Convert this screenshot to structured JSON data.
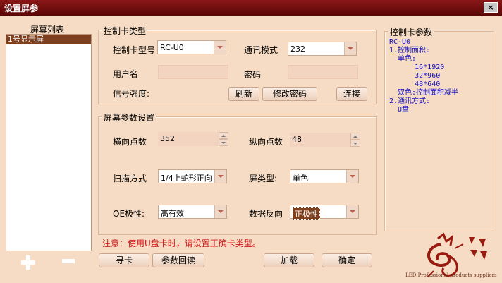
{
  "window": {
    "title": "设置屏参",
    "close_label": "×"
  },
  "screen_list": {
    "label": "屏幕列表",
    "items": [
      "1号显示屏"
    ]
  },
  "card_type": {
    "legend": "控制卡类型",
    "model_label": "控制卡型号",
    "model_value": "RC-U0",
    "comm_label": "通讯模式",
    "comm_value": "232",
    "username_label": "用户名",
    "password_label": "密码",
    "signal_label": "信号强度:",
    "refresh_label": "刷新",
    "change_pw_label": "修改密码",
    "connect_label": "连接"
  },
  "screen_params": {
    "legend": "屏幕参数设置",
    "width_label": "横向点数",
    "width_value": "352",
    "height_label": "纵向点数",
    "height_value": "48",
    "scan_label": "扫描方式",
    "scan_value": "1/4上蛇形正向",
    "screen_type_label": "屏类型:",
    "screen_type_value": "单色",
    "oe_label": "OE极性:",
    "oe_value": "高有效",
    "data_label": "数据反向",
    "data_value": "正极性"
  },
  "card_params": {
    "legend": "控制卡参数",
    "text": "RC-U0\n1.控制面积:\n  单色:\n      16*1920\n      32*960\n      48*640\n  双色:控制面积减半\n2.通讯方式:\n  U盘"
  },
  "notice": "注意：使用U盘卡时，请设置正确卡类型。",
  "buttons": {
    "search": "寻卡",
    "readback": "参数回读",
    "load": "加载",
    "ok": "确定"
  },
  "logo": {
    "caption": "LED Professional products suppliers"
  },
  "colors": {
    "title_bar": "#7a1010",
    "background": "#f6dcc4",
    "notice": "#d01818",
    "info_text": "#1010c8",
    "selected_item": "#7e3f1e"
  }
}
